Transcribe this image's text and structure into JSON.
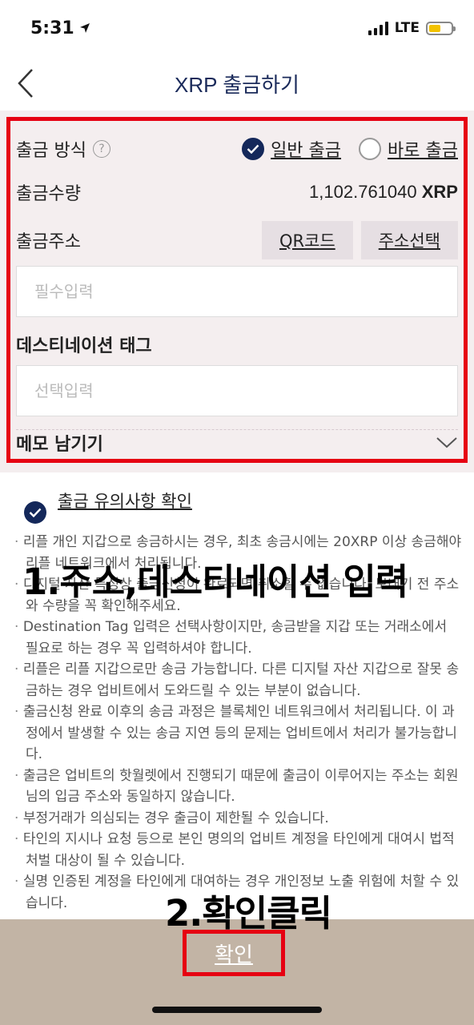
{
  "status_bar": {
    "time": "5:31",
    "network": "LTE"
  },
  "header": {
    "title": "XRP 출금하기"
  },
  "form": {
    "method_label": "출금 방식",
    "method_options": [
      {
        "label": "일반 출금",
        "selected": true
      },
      {
        "label": "바로 출금",
        "selected": false
      }
    ],
    "amount_label": "출금수량",
    "amount_value": "1,102.761040",
    "amount_unit": "XRP",
    "address_label": "출금주소",
    "qr_button": "QR코드",
    "address_select_button": "주소선택",
    "address_placeholder": "필수입력",
    "tag_label": "데스티네이션 태그",
    "tag_placeholder": "선택입력",
    "memo_label": "메모 남기기"
  },
  "notice": {
    "check_label": "출금 유의사항 확인",
    "items": [
      "리플 개인 지갑으로 송금하시는 경우, 최초 송금시에는 20XRP 이상 송금해야 리플 네트워크에서 처리됩니다.",
      "디지털 자산 특성상 출금신청이 완료되면 취소할 수 없습니다. 보내기 전 주소와 수량을 꼭 확인해주세요.",
      "Destination Tag 입력은 선택사항이지만, 송금받을 지갑 또는 거래소에서 필요로 하는 경우 꼭 입력하셔야 합니다.",
      "리플은 리플 지갑으로만 송금 가능합니다. 다른 디지털 자산 지갑으로 잘못 송금하는 경우 업비트에서 도와드릴 수 있는 부분이 없습니다.",
      "출금신청 완료 이후의 송금 과정은 블록체인 네트워크에서 처리됩니다. 이 과정에서 발생할 수 있는 송금 지연 등의 문제는 업비트에서 처리가 불가능합니다.",
      "출금은 업비트의 핫월렛에서 진행되기 때문에 출금이 이루어지는 주소는 회원님의 입금 주소와 동일하지 않습니다.",
      "부정거래가 의심되는 경우 출금이 제한될 수 있습니다.",
      "타인의 지시나 요청 등으로 본인 명의의 업비트 계정을 타인에게 대여시 법적 처벌 대상이 될 수 있습니다.",
      "실명 인증된 계정을 타인에게 대여하는 경우 개인정보 노출 위험에 처할 수 있습니다."
    ]
  },
  "annotations": {
    "step1": "1.주소,데스티네이션 입력",
    "step2": "2.확인클릭"
  },
  "footer": {
    "confirm_button": "확인"
  },
  "colors": {
    "navy": "#14285a",
    "form_bg": "#f4eeef",
    "footer_bg": "#c2b4a5",
    "highlight_red": "#e60012"
  }
}
